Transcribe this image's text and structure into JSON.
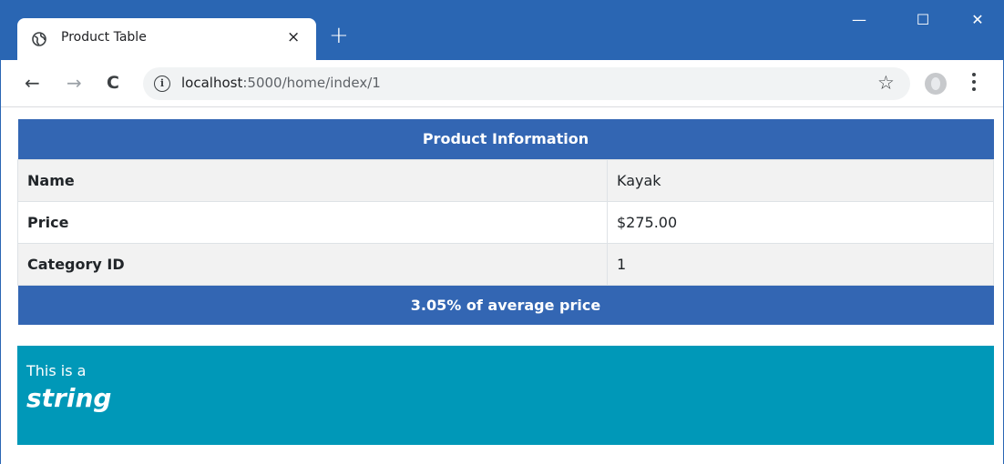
{
  "browser": {
    "tab_title": "Product Table",
    "tab_close": "×",
    "new_tab": "+",
    "minimize": "—",
    "maximize": "☐",
    "close": "✕",
    "back": "←",
    "forward": "→",
    "reload": "C",
    "info": "i",
    "url_host": "localhost",
    "url_path": ":5000/home/index/1",
    "star": "☆"
  },
  "table": {
    "header": "Product Information",
    "rows": [
      {
        "label": "Name",
        "value": "Kayak"
      },
      {
        "label": "Price",
        "value": "$275.00"
      },
      {
        "label": "Category ID",
        "value": "1"
      }
    ],
    "footer": "3.05% of average price"
  },
  "alert": {
    "prefix": "This is a",
    "emphasis": "string",
    "color": "#0098b8"
  },
  "colors": {
    "titlebar": "#2a66b3",
    "table_header": "#3366b3"
  }
}
